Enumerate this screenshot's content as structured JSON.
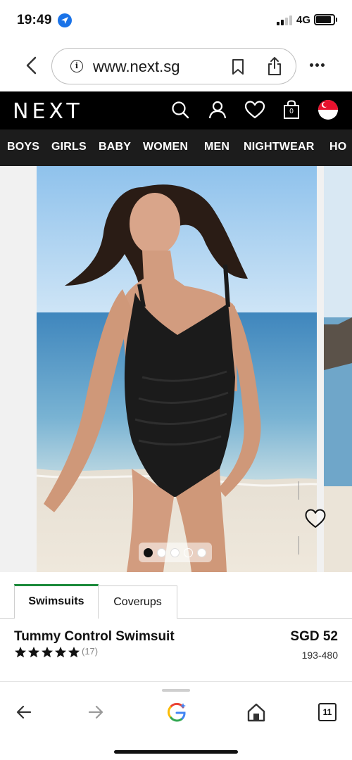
{
  "status_bar": {
    "time": "19:49",
    "network": "4G"
  },
  "browser": {
    "url": "www.next.sg",
    "tab_count": "11"
  },
  "site": {
    "logo": "NEXT",
    "bag_count": "0",
    "nav_items": [
      "BOYS",
      "GIRLS",
      "BABY",
      "WOMEN",
      "MEN",
      "NIGHTWEAR",
      "HO"
    ]
  },
  "carousel": {
    "slide_count": 5,
    "active_slide": 1
  },
  "tabs": [
    {
      "label": "Swimsuits",
      "active": true
    },
    {
      "label": "Coverups",
      "active": false
    }
  ],
  "product": {
    "name": "Tummy Control Swimsuit",
    "rating_stars": 5,
    "review_count": "(17)",
    "price": "SGD 52",
    "item_number": "193-480"
  },
  "colors": {
    "brand_black": "#000000",
    "nav_bg": "#1c1c1c",
    "active_tab_accent": "#1b8a3a",
    "location_blue": "#1a73e8"
  },
  "icons": {
    "header": [
      "search-icon",
      "account-icon",
      "heart-icon",
      "bag-icon",
      "flag-icon"
    ],
    "toolbar": [
      "back-arrow-icon",
      "forward-arrow-icon",
      "google-lens-icon",
      "home-icon",
      "tabs-icon"
    ]
  }
}
